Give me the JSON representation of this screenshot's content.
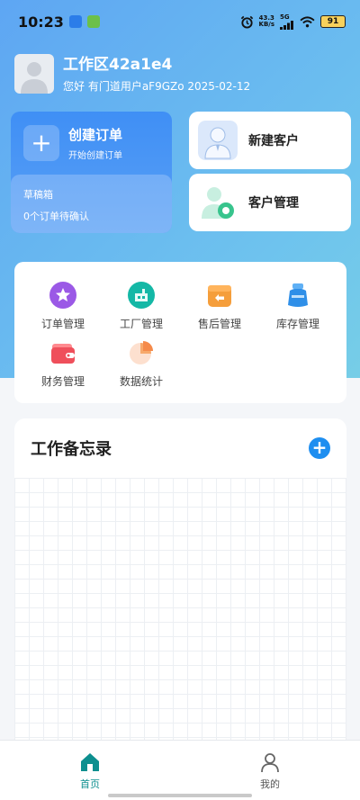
{
  "status_bar": {
    "time": "10:23",
    "net_speed_value": "43.3",
    "net_speed_unit": "KB/s",
    "network": "5G",
    "battery": "91"
  },
  "header": {
    "workspace_title": "工作区42a1e4",
    "greeting": "您好 有门道用户aF9GZo 2025-02-12"
  },
  "create_order": {
    "title": "创建订单",
    "subtitle": "开始创建订单",
    "draft_title": "草稿箱",
    "draft_subtitle": "0个订单待确认"
  },
  "side_cards": {
    "new_customer": "新建客户",
    "customer_management": "客户管理"
  },
  "features": [
    {
      "label": "订单管理",
      "icon": "star-badge-icon",
      "color": "#9b59e6"
    },
    {
      "label": "工厂管理",
      "icon": "factory-icon",
      "color": "#14b8a6"
    },
    {
      "label": "售后管理",
      "icon": "return-box-icon",
      "color": "#f59e3b"
    },
    {
      "label": "库存管理",
      "icon": "inventory-bag-icon",
      "color": "#2f8fe8"
    },
    {
      "label": "财务管理",
      "icon": "wallet-icon",
      "color": "#ef4f5b"
    },
    {
      "label": "数据统计",
      "icon": "pie-chart-icon",
      "color": "#f7a96b"
    }
  ],
  "memo": {
    "title": "工作备忘录"
  },
  "bottom_nav": {
    "home": "首页",
    "mine": "我的"
  },
  "colors": {
    "accent_blue": "#3f8ff5",
    "nav_active": "#0d8f8f",
    "memo_add": "#1e8ef0"
  }
}
